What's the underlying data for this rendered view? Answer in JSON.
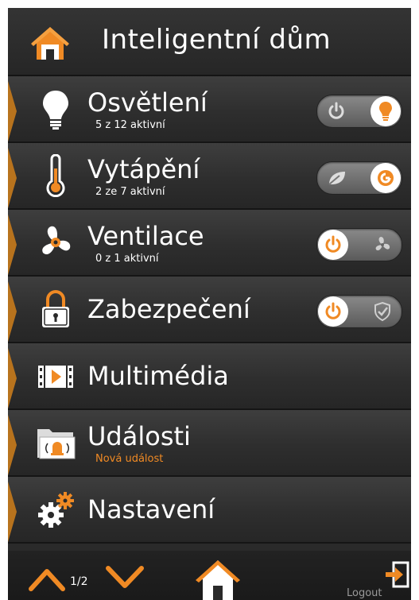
{
  "header": {
    "title": "Inteligentní dům",
    "icon": "home-icon"
  },
  "menu": [
    {
      "label": "Osvětlení",
      "sub": "5 z 12 aktivní",
      "icon": "light-bulb-icon",
      "toggle": "on"
    },
    {
      "label": "Vytápění",
      "sub": "2 ze 7 aktivní",
      "icon": "thermometer-icon",
      "toggle": "on"
    },
    {
      "label": "Ventilace",
      "sub": "0 z 1 aktivní",
      "icon": "fan-icon",
      "toggle": "off"
    },
    {
      "label": "Zabezpečení",
      "icon": "padlock-icon",
      "toggle": "off"
    },
    {
      "label": "Multimédia",
      "icon": "film-icon"
    },
    {
      "label": "Události",
      "sub": "Nová událost",
      "icon": "alarm-folder-icon"
    },
    {
      "label": "Nastavení",
      "icon": "gears-icon"
    }
  ],
  "footer": {
    "page": "1/2",
    "logout_label": "Logout"
  },
  "colors": {
    "accent": "#f08a24",
    "background": "#2a2a2a",
    "text": "#ffffff",
    "tab": "#b8731d"
  }
}
